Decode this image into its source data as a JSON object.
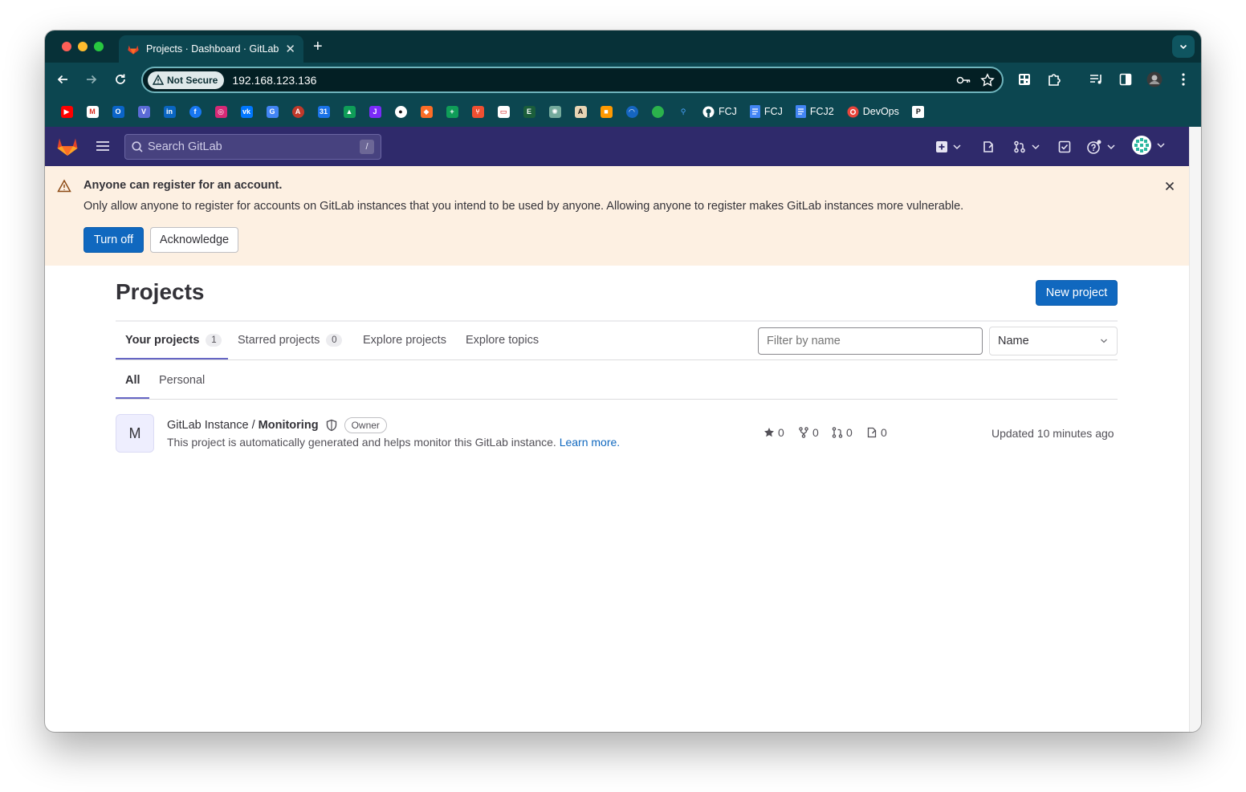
{
  "browser": {
    "tab_title": "Projects · Dashboard · GitLab",
    "security_label": "Not Secure",
    "url": "192.168.123.136",
    "bookmarks": [
      {
        "label": "FCJ"
      },
      {
        "label": "FCJ"
      },
      {
        "label": "FCJ2"
      },
      {
        "label": "DevOps"
      }
    ]
  },
  "gitlab": {
    "search_placeholder": "Search GitLab",
    "search_shortcut": "/"
  },
  "alert": {
    "title": "Anyone can register for an account.",
    "body": "Only allow anyone to register for accounts on GitLab instances that you intend to be used by anyone. Allowing anyone to register makes GitLab instances more vulnerable.",
    "turn_off_label": "Turn off",
    "acknowledge_label": "Acknowledge"
  },
  "page": {
    "title": "Projects",
    "new_project_label": "New project"
  },
  "tabs": [
    {
      "label": "Your projects",
      "count": "1"
    },
    {
      "label": "Starred projects",
      "count": "0"
    },
    {
      "label": "Explore projects"
    },
    {
      "label": "Explore topics"
    }
  ],
  "filter": {
    "placeholder": "Filter by name",
    "sort_value": "Name"
  },
  "subtabs": [
    {
      "label": "All"
    },
    {
      "label": "Personal"
    }
  ],
  "projects": [
    {
      "avatar_letter": "M",
      "namespace": "GitLab Instance / ",
      "name": "Monitoring",
      "role": "Owner",
      "description": "This project is automatically generated and helps monitor this GitLab instance.",
      "learn_more": "Learn more.",
      "stars": "0",
      "forks": "0",
      "merge_requests": "0",
      "issues": "0",
      "updated": "Updated 10 minutes ago"
    }
  ],
  "colors": {
    "gitlab_topbar": "#2f2a6b",
    "alert_bg": "#fdf0e2",
    "primary": "#1068bf",
    "chrome_bg": "#0c4650"
  }
}
